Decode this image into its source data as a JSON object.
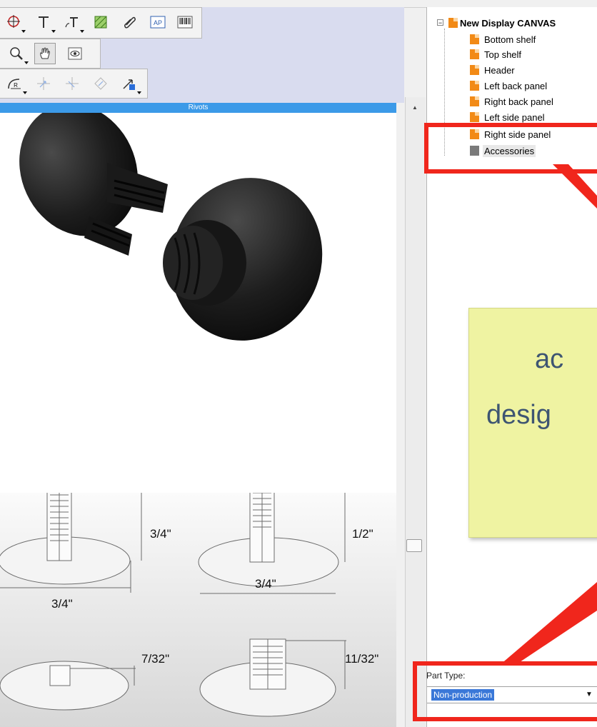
{
  "toolbars": {
    "row1": [
      "crosshair-icon",
      "text-tool-icon",
      "text-path-icon",
      "pattern-fill-icon",
      "paperclip-icon",
      "ap-icon",
      "barcode-icon"
    ],
    "ap_label": "AP",
    "row2": [
      "zoom-icon",
      "pan-hand-icon",
      "view-eye-icon"
    ],
    "row3": [
      "radius-icon",
      "move-node-icon",
      "move-node-alt-icon",
      "rotate-node-icon",
      "transform-icon"
    ],
    "radius_label": "R"
  },
  "image_panel": {
    "title": "Rivots",
    "dimensions": {
      "top_left_height": "3/4\"",
      "top_left_width": "3/4\"",
      "top_right_height": "1/2\"",
      "top_right_width": "3/4\"",
      "bottom_left_height": "7/32\"",
      "bottom_right_height": "11/32\""
    }
  },
  "tree": {
    "root": "New Display CANVAS",
    "items": [
      {
        "label": "Bottom shelf",
        "icon": "orange-part-icon"
      },
      {
        "label": "Top shelf",
        "icon": "orange-part-icon"
      },
      {
        "label": "Header",
        "icon": "orange-part-icon"
      },
      {
        "label": "Left back panel",
        "icon": "orange-part-icon"
      },
      {
        "label": "Right back panel",
        "icon": "orange-part-icon"
      },
      {
        "label": "Left side panel",
        "icon": "orange-part-icon"
      },
      {
        "label": "Right side panel",
        "icon": "orange-part-icon"
      },
      {
        "label": "Accessories",
        "icon": "gray-part-icon"
      }
    ]
  },
  "note": {
    "line1": "ac",
    "line2": "desig"
  },
  "part_type": {
    "label": "Part Type:",
    "value": "Non-production"
  },
  "colors": {
    "panel_title_bar": "#3c9ae8",
    "callout_red": "#f0261c",
    "note_yellow": "#eff3a2",
    "note_text": "#3e5572",
    "tree_part_orange": "#f28a16",
    "selection_blue": "#3a78d8"
  }
}
